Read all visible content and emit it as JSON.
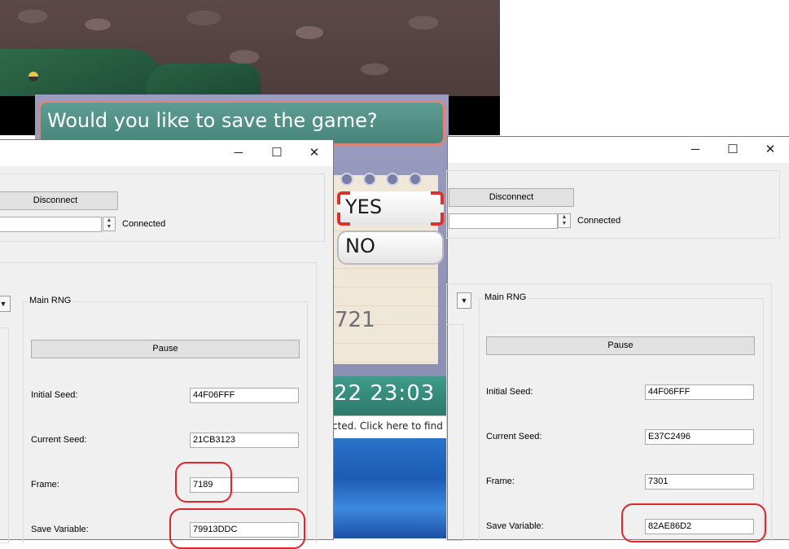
{
  "game": {
    "dialog_text": "Would you like to save the game?",
    "yes_label": "YES",
    "no_label": "NO",
    "number_display": "721",
    "clock_display": "22  23:03",
    "browser_text": "cted. Click here to find a ro"
  },
  "left_window": {
    "connect_button": "Disconnect",
    "status": "Connected",
    "group_title": "Main RNG",
    "pause_button": "Pause",
    "initial_seed_label": "Initial Seed:",
    "initial_seed_value": "44F06FFF",
    "current_seed_label": "Current Seed:",
    "current_seed_value": "21CB3123",
    "frame_label": "Frame:",
    "frame_value": "7189",
    "save_variable_label": "Save Variable:",
    "save_variable_value": "79913DDC"
  },
  "right_window": {
    "connect_button": "Disconnect",
    "status": "Connected",
    "group_title": "Main RNG",
    "pause_button": "Pause",
    "initial_seed_label": "Initial Seed:",
    "initial_seed_value": "44F06FFF",
    "current_seed_label": "Current Seed:",
    "current_seed_value": "E37C2496",
    "frame_label": "Frame:",
    "frame_value": "7301",
    "save_variable_label": "Save Variable:",
    "save_variable_value": "82AE86D2"
  },
  "window_controls": {
    "minimize": "─",
    "maximize": "☐",
    "close": "✕"
  },
  "colors": {
    "highlight_circle": "#e0262b",
    "dialog_teal": "#5e9d94"
  }
}
